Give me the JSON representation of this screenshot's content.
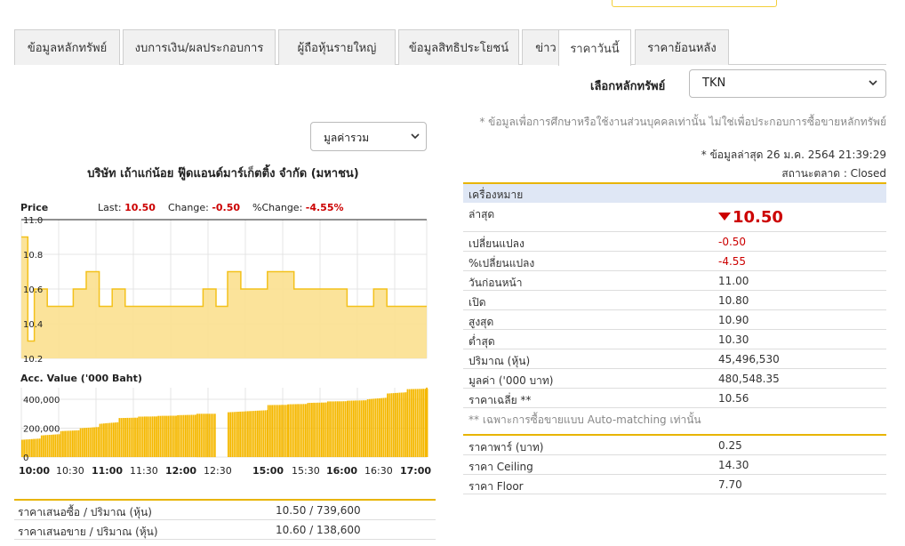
{
  "tabs": [
    {
      "label": "ข้อมูลหลักทรัพย์"
    },
    {
      "label": "งบการเงิน/ผลประกอบการ"
    },
    {
      "label": "ผู้ถือหุ้นรายใหญ่"
    },
    {
      "label": "ข้อมูลสิทธิประโยชน์"
    },
    {
      "label": "ข่าว"
    },
    {
      "label": "ราคาวันนี้"
    },
    {
      "label": "ราคาย้อนหลัง"
    }
  ],
  "selector": {
    "label": "เลือกหลักทรัพย์",
    "value": "TKN"
  },
  "value_select": {
    "value": "มูลค่ารวม"
  },
  "company_title": "บริษัท เถ้าแก่น้อย ฟู๊ดแอนด์มาร์เก็ตติ้ง จำกัด (มหาชน)",
  "price_header": {
    "label": "Price",
    "last_label": "Last:",
    "last": "10.50",
    "change_label": "Change:",
    "change": "-0.50",
    "pct_label": "%Change:",
    "pct": "-4.55%"
  },
  "acc_label": "Acc. Value ('000 Baht)",
  "time_axis": [
    "10:00",
    "10:30",
    "11:00",
    "11:30",
    "12:00",
    "12:30",
    "15:00",
    "15:30",
    "16:00",
    "16:30",
    "17:00"
  ],
  "chart_data": [
    {
      "type": "area",
      "title": "",
      "ylabel": "Price",
      "ylim": [
        10.2,
        11.0
      ],
      "yticks": [
        "11.0",
        "10.8",
        "10.6",
        "10.4",
        "10.2"
      ],
      "x": [
        "10:00",
        "10:05",
        "10:10",
        "10:20",
        "10:40",
        "10:50",
        "11:00",
        "11:10",
        "11:20",
        "11:40",
        "12:00",
        "12:20",
        "12:30",
        "14:30",
        "14:40",
        "15:00",
        "15:20",
        "15:40",
        "16:00",
        "16:20",
        "16:30",
        "16:45",
        "17:00"
      ],
      "values": [
        10.9,
        10.3,
        10.6,
        10.5,
        10.6,
        10.7,
        10.5,
        10.6,
        10.5,
        10.5,
        10.5,
        10.6,
        10.5,
        10.7,
        10.6,
        10.7,
        10.6,
        10.6,
        10.5,
        10.6,
        10.5,
        10.5,
        10.5
      ],
      "reference_line": 11.0,
      "color": "#f3c11b"
    },
    {
      "type": "bar",
      "title": "",
      "ylabel": "Acc. Value ('000 Baht)",
      "ylim": [
        0,
        480000
      ],
      "yticks": [
        "400,000",
        "200,000",
        "0"
      ],
      "x": [
        "10:00",
        "10:15",
        "10:30",
        "10:45",
        "11:00",
        "11:15",
        "11:30",
        "11:45",
        "12:00",
        "12:15",
        "12:30",
        "14:30",
        "15:00",
        "15:15",
        "15:30",
        "15:45",
        "16:00",
        "16:15",
        "16:30",
        "16:45",
        "17:00"
      ],
      "values": [
        120000,
        150000,
        180000,
        200000,
        230000,
        270000,
        280000,
        285000,
        290000,
        300000,
        0,
        310000,
        360000,
        365000,
        375000,
        385000,
        390000,
        400000,
        440000,
        470000,
        480548
      ],
      "color": "#f5b800"
    }
  ],
  "bidask": [
    {
      "label": "ราคาเสนอซื้อ / ปริมาณ (หุ้น)",
      "value": "10.50  /  739,600"
    },
    {
      "label": "ราคาเสนอขาย / ปริมาณ (หุ้น)",
      "value": "10.60  /  138,600"
    }
  ],
  "notes": {
    "disclaimer": "* ข้อมูลเพื่อการศึกษาหรือใช้งานส่วนบุคคลเท่านั้น ไม่ใช่เพื่อประกอบการซื้อขายหลักทรัพย์",
    "updated": "* ข้อมูลล่าสุด 26 ม.ค. 2564 21:39:29",
    "status": "สถานะตลาด : Closed"
  },
  "quote": {
    "header": "เครื่องหมาย",
    "last_label": "ล่าสุด",
    "last_value": "10.50",
    "rows": [
      {
        "label": "เปลี่ยนแปลง",
        "value": "-0.50",
        "red": true
      },
      {
        "label": "%เปลี่ยนแปลง",
        "value": "-4.55",
        "red": true
      },
      {
        "label": "วันก่อนหน้า",
        "value": "11.00",
        "red": false
      },
      {
        "label": "เปิด",
        "value": "10.80",
        "red": false
      },
      {
        "label": "สูงสุด",
        "value": "10.90",
        "red": false
      },
      {
        "label": "ต่ำสุด",
        "value": "10.30",
        "red": false
      },
      {
        "label": "ปริมาณ (หุ้น)",
        "value": "45,496,530",
        "red": false
      },
      {
        "label": "มูลค่า ('000 บาท)",
        "value": "480,548.35",
        "red": false
      },
      {
        "label": "ราคาเฉลี่ย **",
        "value": "10.56",
        "red": false
      }
    ],
    "footnote": "** เฉพาะการซื้อขายแบบ Auto-matching เท่านั้น"
  },
  "quote2": [
    {
      "label": "ราคาพาร์ (บาท)",
      "value": "0.25"
    },
    {
      "label": "ราคา Ceiling",
      "value": "14.30"
    },
    {
      "label": "ราคา Floor",
      "value": "7.70"
    }
  ],
  "colors": {
    "accent": "#e8b400",
    "negative": "#cc0000",
    "header_bg": "#dfe7f5"
  }
}
